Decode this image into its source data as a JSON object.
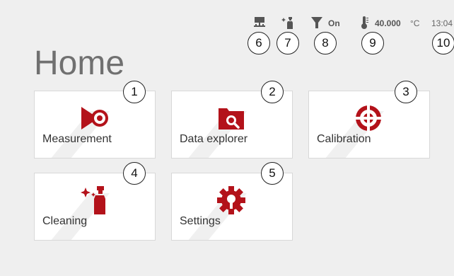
{
  "header": {
    "title": "Home"
  },
  "status_bar": {
    "filter_state": "On",
    "temperature_value": "40.000",
    "temperature_unit": "°C",
    "time": "13:04"
  },
  "callouts": [
    "1",
    "2",
    "3",
    "4",
    "5",
    "6",
    "7",
    "8",
    "9",
    "10"
  ],
  "tiles": [
    {
      "label": "Measurement",
      "icon": "measurement-icon"
    },
    {
      "label": "Data explorer",
      "icon": "data-explorer-icon"
    },
    {
      "label": "Calibration",
      "icon": "calibration-icon"
    },
    {
      "label": "Cleaning",
      "icon": "cleaning-icon"
    },
    {
      "label": "Settings",
      "icon": "settings-icon"
    }
  ],
  "colors": {
    "accent": "#b3121a",
    "background": "#efefef",
    "tile": "#ffffff",
    "title": "#707070",
    "status_icon": "#555555"
  }
}
